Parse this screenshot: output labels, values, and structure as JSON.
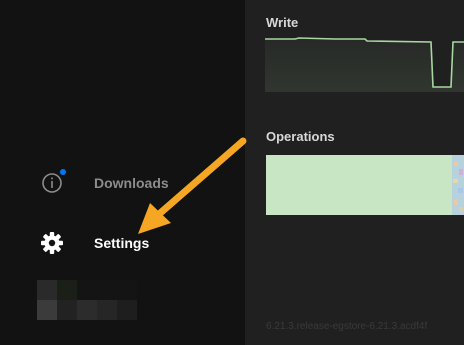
{
  "sidebar": {
    "items": [
      {
        "label": "Downloads",
        "icon": "info-circle-icon",
        "has_notification": true
      },
      {
        "label": "Settings",
        "icon": "gear-icon"
      }
    ]
  },
  "main": {
    "write": {
      "title": "Write"
    },
    "operations": {
      "title": "Operations"
    },
    "version": "6.21.3.release-egstore-6.21.3.acdf4f"
  },
  "colors": {
    "graph_line": "#a8d8a0",
    "operations_fill": "#c8e6c3",
    "notification_badge": "#0078f2",
    "annotation_arrow": "#f5a623"
  }
}
